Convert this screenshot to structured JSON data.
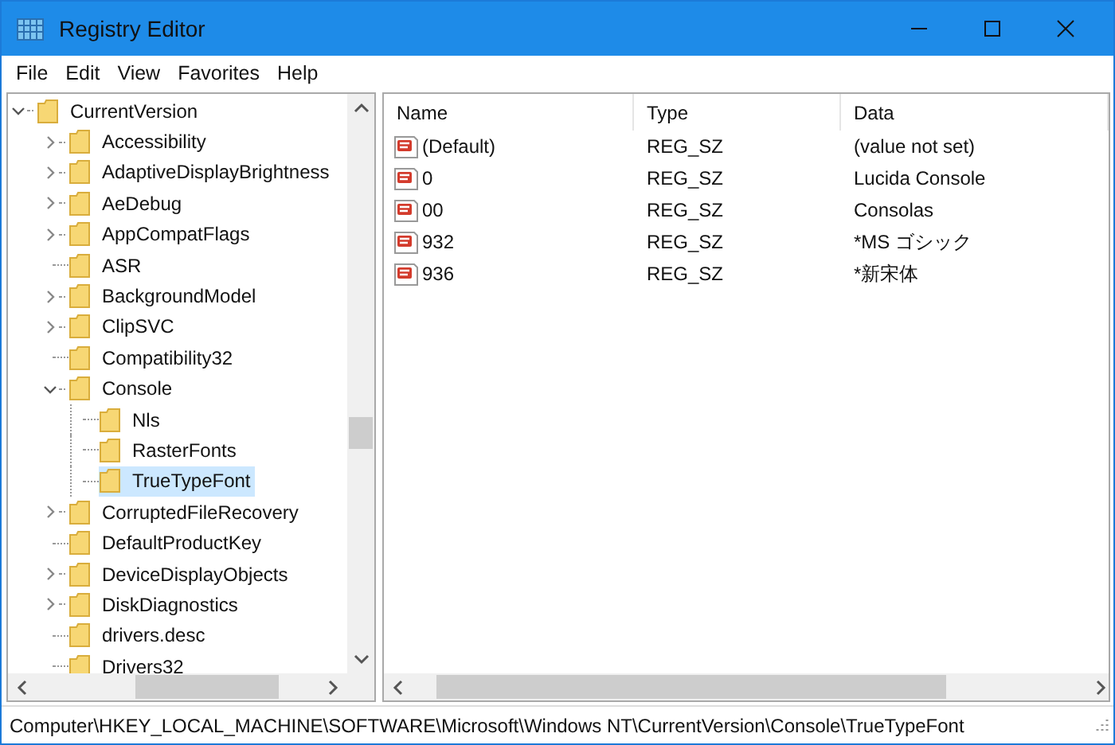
{
  "window": {
    "title": "Registry Editor"
  },
  "menu": [
    "File",
    "Edit",
    "View",
    "Favorites",
    "Help"
  ],
  "tree": {
    "label": "CurrentVersion",
    "kind": "branch",
    "expanded": true,
    "selected": false,
    "children": [
      {
        "label": "Accessibility",
        "kind": "branch",
        "expanded": false,
        "selected": false
      },
      {
        "label": "AdaptiveDisplayBrightness",
        "kind": "branch",
        "expanded": false,
        "selected": false
      },
      {
        "label": "AeDebug",
        "kind": "branch",
        "expanded": false,
        "selected": false
      },
      {
        "label": "AppCompatFlags",
        "kind": "branch",
        "expanded": false,
        "selected": false
      },
      {
        "label": "ASR",
        "kind": "leaf",
        "selected": false
      },
      {
        "label": "BackgroundModel",
        "kind": "branch",
        "expanded": false,
        "selected": false
      },
      {
        "label": "ClipSVC",
        "kind": "branch",
        "expanded": false,
        "selected": false
      },
      {
        "label": "Compatibility32",
        "kind": "leaf",
        "selected": false
      },
      {
        "label": "Console",
        "kind": "branch",
        "expanded": true,
        "selected": false,
        "children": [
          {
            "label": "Nls",
            "kind": "leaf",
            "selected": false
          },
          {
            "label": "RasterFonts",
            "kind": "leaf",
            "selected": false
          },
          {
            "label": "TrueTypeFont",
            "kind": "leaf",
            "selected": true
          }
        ]
      },
      {
        "label": "CorruptedFileRecovery",
        "kind": "branch",
        "expanded": false,
        "selected": false
      },
      {
        "label": "DefaultProductKey",
        "kind": "leaf",
        "selected": false
      },
      {
        "label": "DeviceDisplayObjects",
        "kind": "branch",
        "expanded": false,
        "selected": false
      },
      {
        "label": "DiskDiagnostics",
        "kind": "branch",
        "expanded": false,
        "selected": false
      },
      {
        "label": "drivers.desc",
        "kind": "leaf",
        "selected": false
      },
      {
        "label": "Drivers32",
        "kind": "leaf",
        "selected": false
      }
    ]
  },
  "values": {
    "columns": [
      "Name",
      "Type",
      "Data"
    ],
    "rows": [
      {
        "name": "(Default)",
        "type": "REG_SZ",
        "data": "(value not set)"
      },
      {
        "name": "0",
        "type": "REG_SZ",
        "data": "Lucida Console"
      },
      {
        "name": "00",
        "type": "REG_SZ",
        "data": "Consolas"
      },
      {
        "name": "932",
        "type": "REG_SZ",
        "data": "*MS ゴシック"
      },
      {
        "name": "936",
        "type": "REG_SZ",
        "data": "*新宋体"
      }
    ]
  },
  "status_bar": "Computer\\HKEY_LOCAL_MACHINE\\SOFTWARE\\Microsoft\\Windows NT\\CurrentVersion\\Console\\TrueTypeFont"
}
